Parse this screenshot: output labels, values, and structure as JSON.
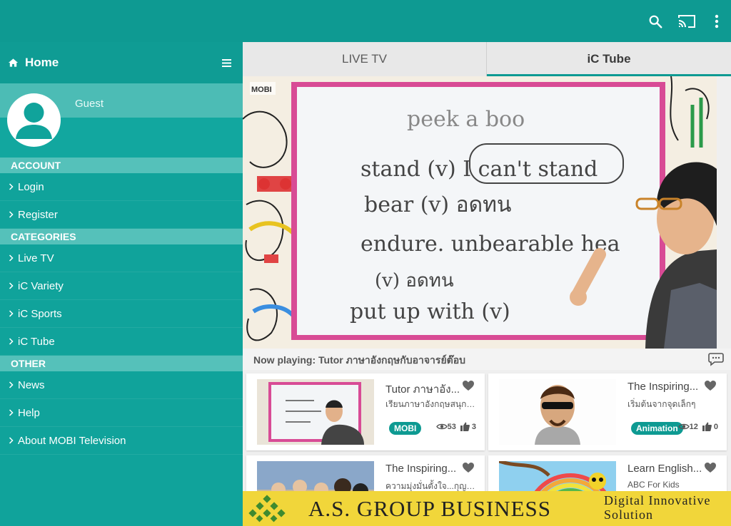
{
  "sidebar": {
    "home_label": "Home",
    "guest_name": "Guest",
    "sections": [
      {
        "title": "ACCOUNT",
        "items": [
          "Login",
          "Register"
        ]
      },
      {
        "title": "CATEGORIES",
        "items": [
          "Live TV",
          "iC Variety",
          "iC Sports",
          "iC Tube"
        ]
      },
      {
        "title": "OTHER",
        "items": [
          "News",
          "Help",
          "About MOBI Television"
        ]
      }
    ]
  },
  "tabs": [
    {
      "label": "LIVE TV",
      "active": false
    },
    {
      "label": "iC Tube",
      "active": true
    }
  ],
  "now_playing": "Now playing: Tutor ภาษาอังกฤษกับอาจารย์ต๊อบ",
  "player": {
    "channel_logo": "MOBI",
    "board_lines": [
      "peek a boo",
      "stand (v) I can't stand",
      "bear (v) อดทน",
      "endure. unbearable hea",
      "(v) อดทน",
      "put up with (v)"
    ]
  },
  "videos": [
    {
      "title": "Tutor ภาษาอัง...",
      "subtitle": "เรียนภาษาอังกฤษสนุกๆ ...",
      "tag": "MOBI",
      "views": "53",
      "likes": "3",
      "thumb": "board"
    },
    {
      "title": "The Inspiring...",
      "subtitle": "เริ่มต้นจากจุดเล็กๆ",
      "tag": "Animation",
      "views": "12",
      "likes": "0",
      "thumb": "cartoon-man"
    },
    {
      "title": "The Inspiring...",
      "subtitle": "ความมุ่งมั่นตั้งใจ...กุญแ...",
      "tag": "",
      "views": "",
      "likes": "",
      "thumb": "crowd"
    },
    {
      "title": "Learn English...",
      "subtitle": "ABC For Kids",
      "tag": "",
      "views": "",
      "likes": "",
      "thumb": "rainbow"
    }
  ],
  "banner": {
    "company": "A.S. GROUP BUSINESS",
    "tagline_1": "Digital Innovative",
    "tagline_2": "Solution"
  },
  "colors": {
    "primary": "#0e9a92",
    "sidebar": "#10a39b",
    "section": "#55c1ba",
    "banner": "#f1d63a"
  },
  "icons": [
    "search-icon",
    "cast-icon",
    "more-vert-icon",
    "home-icon",
    "menu-icon",
    "chevron-right-icon",
    "user-avatar-icon",
    "chat-icon",
    "heart-icon",
    "eye-icon",
    "thumb-up-icon"
  ]
}
